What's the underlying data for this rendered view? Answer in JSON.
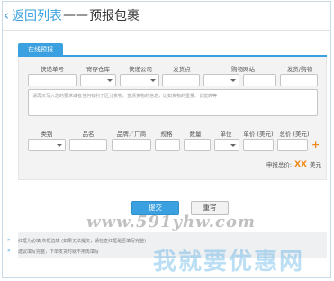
{
  "header": {
    "back_label": "返回列表",
    "separator": "——",
    "title": "预报包裹"
  },
  "tab": {
    "label": "在线预报"
  },
  "row1_labels": {
    "tracking": "快递单号",
    "warehouse": "寄存仓库",
    "courier": "快递公司",
    "ship_from": "发货点",
    "shop_site": "购物网站",
    "shipping": "发货/购物"
  },
  "remark_placeholder": "请再次写入您的要求或者任何有利于区分货物、查清货物的信息，比如货物的重量、长宽高等",
  "row2_labels": {
    "category": "类别",
    "name": "品名",
    "brand": "品牌／厂商",
    "spec": "规格",
    "quantity": "数量",
    "unit": "单位",
    "unit_price": "单价 (美元)",
    "total_price": "总价 (美元)"
  },
  "total": {
    "label": "申报总价:",
    "value": "XX",
    "currency": "美元"
  },
  "buttons": {
    "submit": "提交",
    "reset": "重写"
  },
  "notes": [
    "红框为必填,灰框选填 (如果无法提交，请检查红框是否填写完整)",
    "建议填写完整，下单发货时就不用再填写"
  ],
  "watermark": {
    "url": "www.591yhw.com",
    "text": "我就要优惠网"
  },
  "colors": {
    "accent": "#3aa0df",
    "highlight": "#f08a1c"
  }
}
